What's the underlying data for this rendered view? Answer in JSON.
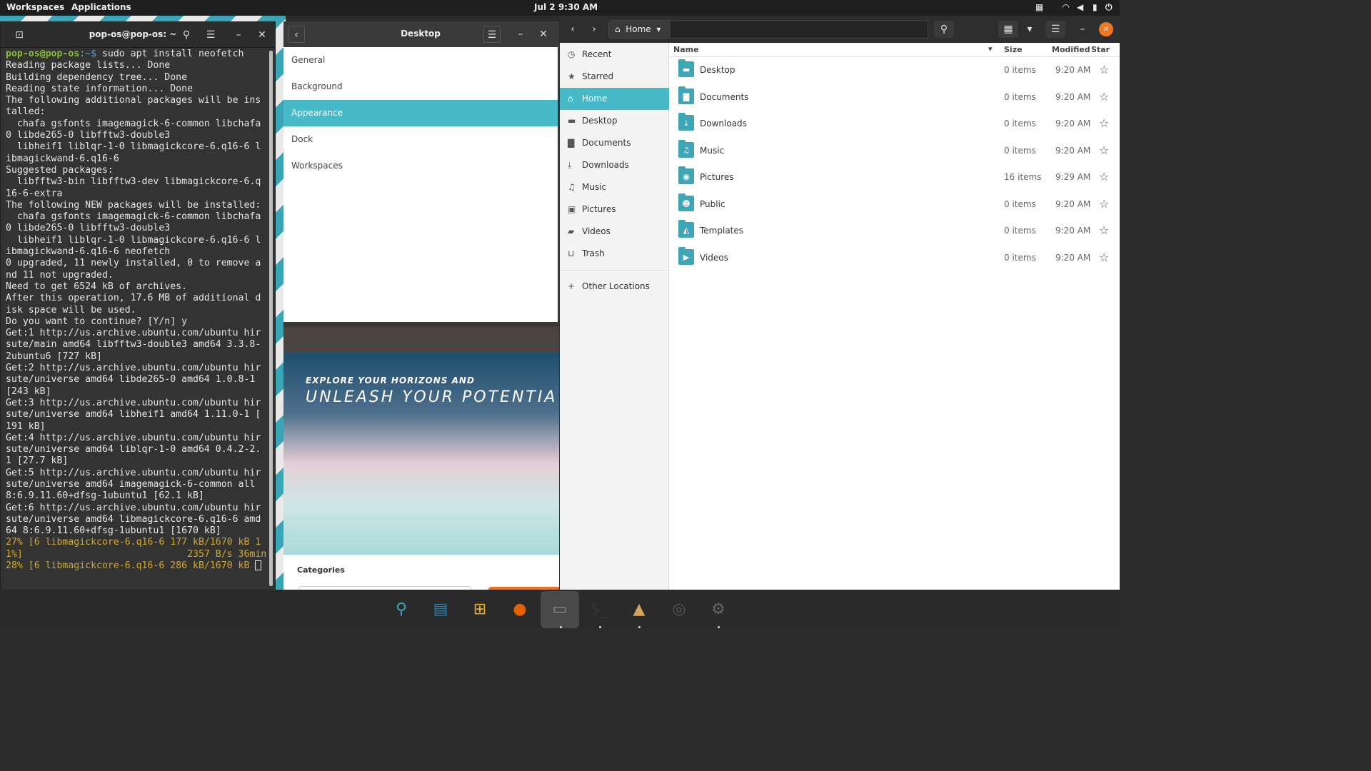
{
  "topbar": {
    "workspaces": "Workspaces",
    "applications": "Applications",
    "clock": "Jul 2  9:30 AM"
  },
  "terminal": {
    "title": "pop-os@pop-os: ~",
    "prompt_user": "pop-os@pop-os",
    "prompt_path": ":~$ ",
    "command": "sudo apt install neofetch",
    "output": "Reading package lists... Done\nBuilding dependency tree... Done\nReading state information... Done\nThe following additional packages will be ins\ntalled:\n  chafa gsfonts imagemagick-6-common libchafa\n0 libde265-0 libfftw3-double3\n  libheif1 liblqr-1-0 libmagickcore-6.q16-6 l\nibmagickwand-6.q16-6\nSuggested packages:\n  libfftw3-bin libfftw3-dev libmagickcore-6.q\n16-6-extra\nThe following NEW packages will be installed:\n  chafa gsfonts imagemagick-6-common libchafa\n0 libde265-0 libfftw3-double3\n  libheif1 liblqr-1-0 libmagickcore-6.q16-6 l\nibmagickwand-6.q16-6 neofetch\n0 upgraded, 11 newly installed, 0 to remove a\nnd 11 not upgraded.\nNeed to get 6524 kB of archives.\nAfter this operation, 17.6 MB of additional d\nisk space will be used.\nDo you want to continue? [Y/n] y\nGet:1 http://us.archive.ubuntu.com/ubuntu hir\nsute/main amd64 libfftw3-double3 amd64 3.3.8-\n2ubuntu6 [727 kB]\nGet:2 http://us.archive.ubuntu.com/ubuntu hir\nsute/universe amd64 libde265-0 amd64 1.0.8-1\n[243 kB]\nGet:3 http://us.archive.ubuntu.com/ubuntu hir\nsute/universe amd64 libheif1 amd64 1.11.0-1 [\n191 kB]\nGet:4 http://us.archive.ubuntu.com/ubuntu hir\nsute/universe amd64 liblqr-1-0 amd64 0.4.2-2.\n1 [27.7 kB]\nGet:5 http://us.archive.ubuntu.com/ubuntu hir\nsute/universe amd64 imagemagick-6-common all\n8:6.9.11.60+dfsg-1ubuntu1 [62.1 kB]\nGet:6 http://us.archive.ubuntu.com/ubuntu hir\nsute/universe amd64 libmagickcore-6.q16-6 amd\n64 8:6.9.11.60+dfsg-1ubuntu1 [1670 kB]",
    "progress": "27% [6 libmagickcore-6.q16-6 177 kB/1670 kB 1\n1%]                             2357 B/s 36min\n28% [6 libmagickcore-6.q16-6 286 kB/1670 kB "
  },
  "settings": {
    "title": "Desktop",
    "items": [
      "General",
      "Background",
      "Appearance",
      "Dock",
      "Workspaces"
    ],
    "selected": "Appearance",
    "banner_line1": "EXPLORE YOUR HORIZONS AND",
    "banner_line2": "UNLEASH YOUR POTENTIA",
    "categories": "Categories"
  },
  "files": {
    "location": "Home",
    "sidebar": [
      {
        "label": "Recent",
        "icon": "clock-icon",
        "glyph": "◷"
      },
      {
        "label": "Starred",
        "icon": "star-icon",
        "glyph": "★"
      },
      {
        "label": "Home",
        "icon": "home-icon",
        "glyph": "⌂"
      },
      {
        "label": "Desktop",
        "icon": "desktop-icon",
        "glyph": "▬"
      },
      {
        "label": "Documents",
        "icon": "document-icon",
        "glyph": "▇"
      },
      {
        "label": "Downloads",
        "icon": "download-icon",
        "glyph": "⤓"
      },
      {
        "label": "Music",
        "icon": "music-icon",
        "glyph": "♫"
      },
      {
        "label": "Pictures",
        "icon": "picture-icon",
        "glyph": "▣"
      },
      {
        "label": "Videos",
        "icon": "video-icon",
        "glyph": "▰"
      },
      {
        "label": "Trash",
        "icon": "trash-icon",
        "glyph": "⊔"
      }
    ],
    "other_locations": "Other Locations",
    "columns": {
      "name": "Name",
      "size": "Size",
      "modified": "Modified",
      "star": "Star"
    },
    "rows": [
      {
        "name": "Desktop",
        "size": "0 items",
        "modified": "9:20 AM",
        "icon": "desktop-folder-icon",
        "glyph": "▬"
      },
      {
        "name": "Documents",
        "size": "0 items",
        "modified": "9:20 AM",
        "icon": "documents-folder-icon",
        "glyph": "▇"
      },
      {
        "name": "Downloads",
        "size": "0 items",
        "modified": "9:20 AM",
        "icon": "downloads-folder-icon",
        "glyph": "⤓"
      },
      {
        "name": "Music",
        "size": "0 items",
        "modified": "9:20 AM",
        "icon": "music-folder-icon",
        "glyph": "♫"
      },
      {
        "name": "Pictures",
        "size": "16 items",
        "modified": "9:29 AM",
        "icon": "pictures-folder-icon",
        "glyph": "◉"
      },
      {
        "name": "Public",
        "size": "0 items",
        "modified": "9:20 AM",
        "icon": "public-folder-icon",
        "glyph": "☻"
      },
      {
        "name": "Templates",
        "size": "0 items",
        "modified": "9:20 AM",
        "icon": "templates-folder-icon",
        "glyph": "◭"
      },
      {
        "name": "Videos",
        "size": "0 items",
        "modified": "9:20 AM",
        "icon": "videos-folder-icon",
        "glyph": "▶"
      }
    ]
  },
  "dock": [
    {
      "name": "search-app-icon",
      "glyph": "⚲",
      "color": "#3fa6b5"
    },
    {
      "name": "workspaces-app-icon",
      "glyph": "▤",
      "color": "#2f7fb0"
    },
    {
      "name": "applications-grid-icon",
      "glyph": "⊞",
      "color": "#f2b01e"
    },
    {
      "name": "firefox-icon",
      "glyph": "●",
      "color": "#e66000"
    },
    {
      "name": "files-app-icon",
      "glyph": "▭",
      "color": "#8a8a8a"
    },
    {
      "name": "terminal-app-icon",
      "glyph": "$_",
      "color": "#333333"
    },
    {
      "name": "popshop-app-icon",
      "glyph": "▲",
      "color": "#d6a35a"
    },
    {
      "name": "installer-app-icon",
      "glyph": "◎",
      "color": "#555555"
    },
    {
      "name": "settings-app-icon",
      "glyph": "⚙",
      "color": "#666666"
    }
  ]
}
